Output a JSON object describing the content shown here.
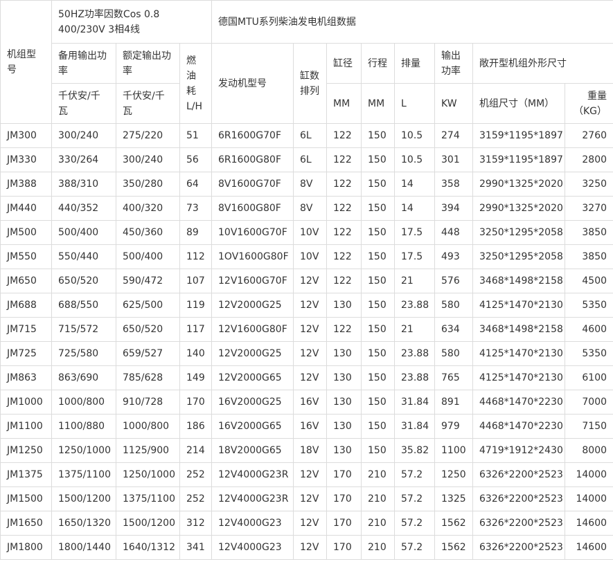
{
  "header": {
    "model_no": "机组型号",
    "rating_group": "50HZ功率因数Cos 0.8 400/230V 3相4线",
    "mtu_title": "德国MTU系列柴油发电机组数据",
    "standby_power": "备用输出功率",
    "prime_power": "额定输出功率",
    "fuel_consumption": "燃油耗L/H",
    "engine_model": "发动机型号",
    "cylinder_arrangement": "缸数排列",
    "bore": "缸径",
    "stroke": "行程",
    "displacement": "排量",
    "output_power": "输出功率",
    "open_type_dimensions": "敞开型机组外形尺寸",
    "unit_kva_kw_1": "千伏安/千瓦",
    "unit_kva_kw_2": "千伏安/千瓦",
    "unit_mm_bore": "MM",
    "unit_mm_stroke": "MM",
    "unit_l": "L",
    "unit_kw": "KW",
    "dimensions_mm": "机组尺寸（MM）",
    "weight_kg": "重量（KG）"
  },
  "rows": [
    [
      "JM300",
      "300/240",
      "275/220",
      "51",
      "6R1600G70F",
      "6L",
      "122",
      "150",
      "10.5",
      "274",
      "3159*1195*1897",
      "2760"
    ],
    [
      "JM330",
      "330/264",
      "300/240",
      "56",
      "6R1600G80F",
      "6L",
      "122",
      "150",
      "10.5",
      "301",
      "3159*1195*1897",
      "2800"
    ],
    [
      "JM388",
      "388/310",
      "350/280",
      "64",
      "8V1600G70F",
      "8V",
      "122",
      "150",
      "14",
      "358",
      "2990*1325*2020",
      "3250"
    ],
    [
      "JM440",
      "440/352",
      "400/320",
      "73",
      "8V1600G80F",
      "8V",
      "122",
      "150",
      "14",
      "394",
      "2990*1325*2020",
      "3270"
    ],
    [
      "JM500",
      "500/400",
      "450/360",
      "89",
      "10V1600G70F",
      "10V",
      "122",
      "150",
      "17.5",
      "448",
      "3250*1295*2058",
      "3850"
    ],
    [
      "JM550",
      "550/440",
      "500/400",
      "112",
      "1OV1600G80F",
      "10V",
      "122",
      "150",
      "17.5",
      "493",
      "3250*1295*2058",
      "3850"
    ],
    [
      "JM650",
      "650/520",
      "590/472",
      "107",
      "12V1600G70F",
      "12V",
      "122",
      "150",
      "21",
      "576",
      "3468*1498*2158",
      "4500"
    ],
    [
      "JM688",
      "688/550",
      "625/500",
      "119",
      "12V2000G25",
      "12V",
      "130",
      "150",
      "23.88",
      "580",
      "4125*1470*2130",
      "5350"
    ],
    [
      "JM715",
      "715/572",
      "650/520",
      "117",
      "12V1600G80F",
      "12V",
      "122",
      "150",
      "21",
      "634",
      "3468*1498*2158",
      "4600"
    ],
    [
      "JM725",
      "725/580",
      "659/527",
      "140",
      "12V2000G25",
      "12V",
      "130",
      "150",
      "23.88",
      "580",
      "4125*1470*2130",
      "5350"
    ],
    [
      "JM863",
      "863/690",
      "785/628",
      "149",
      "12V2000G65",
      "12V",
      "130",
      "150",
      "23.88",
      "765",
      "4125*1470*2130",
      "6100"
    ],
    [
      "JM1000",
      "1000/800",
      "910/728",
      "170",
      "16V2000G25",
      "16V",
      "130",
      "150",
      "31.84",
      "891",
      "4468*1470*2230",
      "7000"
    ],
    [
      "JM1100",
      "1100/880",
      "1000/800",
      "186",
      "16V2000G65",
      "16V",
      "130",
      "150",
      "31.84",
      "979",
      "4468*1470*2230",
      "7150"
    ],
    [
      "JM1250",
      "1250/1000",
      "1125/900",
      "214",
      "18V2000G65",
      "18V",
      "130",
      "150",
      "35.82",
      "1100",
      "4719*1912*2430",
      "8000"
    ],
    [
      "JM1375",
      "1375/1100",
      "1250/1000",
      "252",
      "12V4000G23R",
      "12V",
      "170",
      "210",
      "57.2",
      "1250",
      "6326*2200*2523",
      "14000"
    ],
    [
      "JM1500",
      "1500/1200",
      "1375/1100",
      "252",
      "12V4000G23R",
      "12V",
      "170",
      "210",
      "57.2",
      "1325",
      "6326*2200*2523",
      "14000"
    ],
    [
      "JM1650",
      "1650/1320",
      "1500/1200",
      "312",
      "12V4000G23",
      "12V",
      "170",
      "210",
      "57.2",
      "1562",
      "6326*2200*2523",
      "14600"
    ],
    [
      "JM1800",
      "1800/1440",
      "1640/1312",
      "341",
      "12V4000G23",
      "12V",
      "170",
      "210",
      "57.2",
      "1562",
      "6326*2200*2523",
      "14600"
    ]
  ]
}
